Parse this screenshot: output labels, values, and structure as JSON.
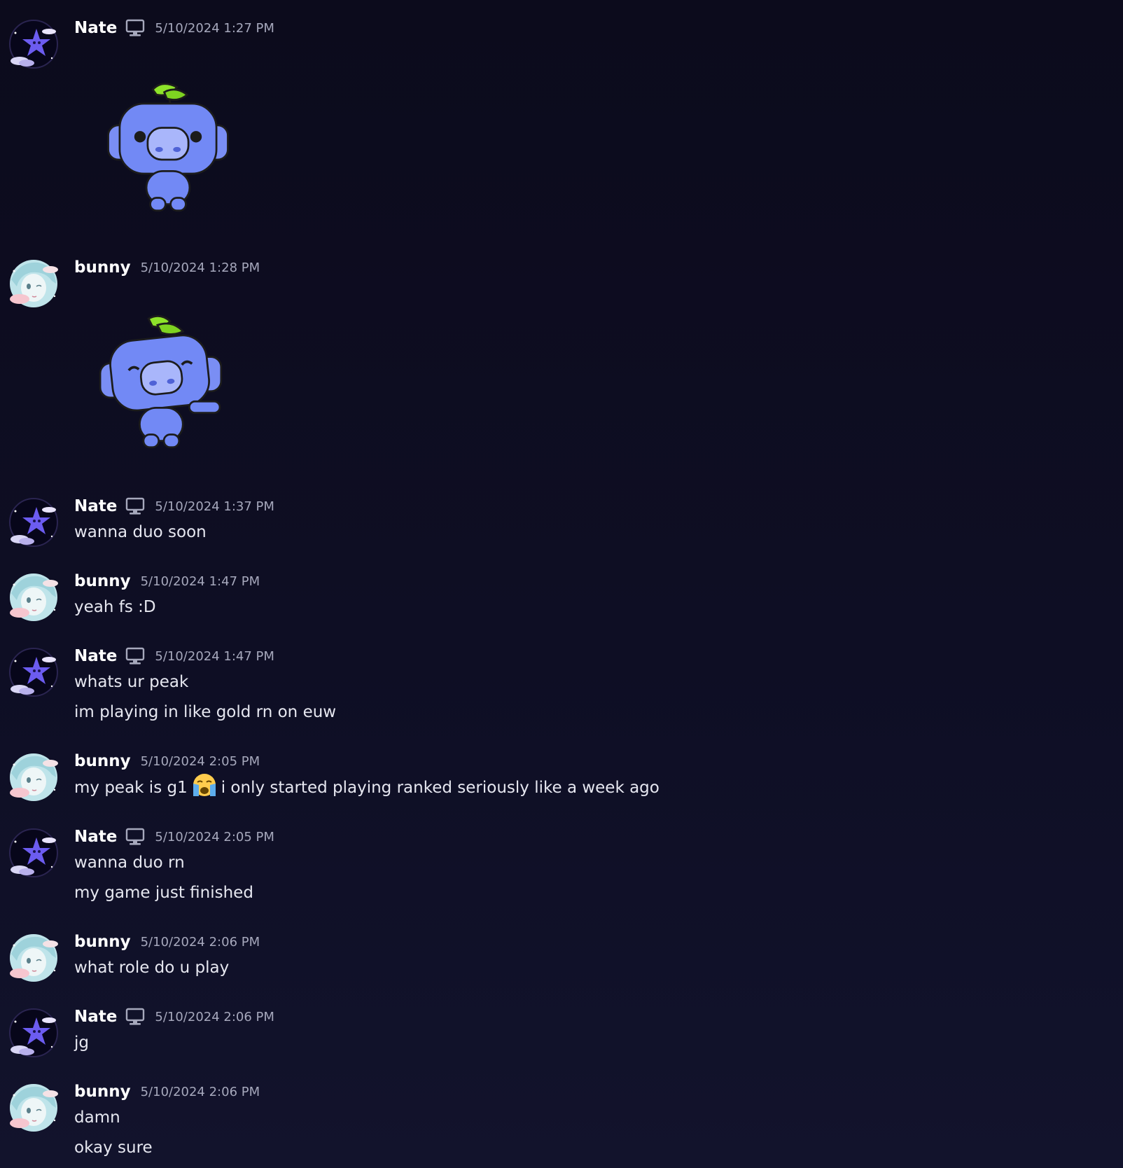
{
  "colors": {
    "background": "#0e0e24",
    "username": "#ffffff",
    "timestamp": "#a6a8bc",
    "text": "#e6e7f0",
    "wumpus": "#7289f5",
    "leaf": "#7ed321"
  },
  "users": {
    "nate": {
      "name": "Nate",
      "device_icon": "desktop-icon",
      "avatar_icon": "purple-star-avatar"
    },
    "bunny": {
      "name": "bunny",
      "avatar_icon": "anime-girl-avatar"
    }
  },
  "messages": [
    {
      "user": "Nate",
      "time": "5/10/2024 1:27 PM",
      "sticker": "wumpus-wave-sticker"
    },
    {
      "user": "bunny",
      "time": "5/10/2024 1:28 PM",
      "sticker": "wumpus-wave-sticker"
    },
    {
      "user": "Nate",
      "time": "5/10/2024 1:37 PM",
      "lines": [
        "wanna duo soon"
      ]
    },
    {
      "user": "bunny",
      "time": "5/10/2024 1:47 PM",
      "lines": [
        "yeah fs :D"
      ]
    },
    {
      "user": "Nate",
      "time": "5/10/2024 1:47 PM",
      "lines": [
        "whats ur peak",
        "im playing in like gold rn on euw"
      ]
    },
    {
      "user": "bunny",
      "time": "5/10/2024 2:05 PM",
      "line_parts": {
        "before": "my peak is g1",
        "emoji": "loudly-crying-emoji",
        "after": "i only started playing ranked seriously like a week ago"
      }
    },
    {
      "user": "Nate",
      "time": "5/10/2024 2:05 PM",
      "lines": [
        "wanna duo rn",
        "my game just finished"
      ]
    },
    {
      "user": "bunny",
      "time": "5/10/2024 2:06 PM",
      "lines": [
        "what role do u play"
      ]
    },
    {
      "user": "Nate",
      "time": "5/10/2024 2:06 PM",
      "lines": [
        "jg"
      ]
    },
    {
      "user": "bunny",
      "time": "5/10/2024 2:06 PM",
      "lines": [
        "damn",
        "okay sure"
      ]
    }
  ]
}
